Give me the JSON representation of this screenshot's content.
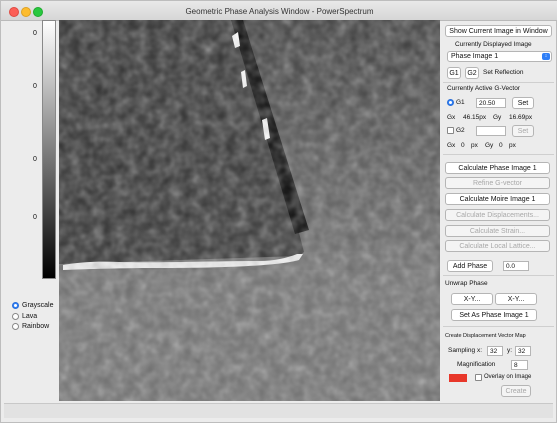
{
  "window": {
    "title": "Geometric Phase Analysis Window - PowerSpectrum"
  },
  "colorbar": {
    "labels": [
      "0",
      "0",
      "0",
      "0"
    ]
  },
  "colormap": {
    "options": [
      "Grayscale",
      "Lava",
      "Rainbow"
    ],
    "selected": "Grayscale"
  },
  "panel": {
    "show_current_btn": "Show Current Image in Window",
    "currently_displayed_label": "Currently Displayed Image",
    "displayed_select": "Phase Image 1",
    "g1_btn": "G1",
    "g2_btn": "G2",
    "set_reflection": "Set Reflection",
    "active_gvector_label": "Currently Active G-Vector",
    "g1_label": "G1",
    "g1_value": "20.50",
    "g1_set_btn": "Set",
    "gx_label": "Gx",
    "gx_value": "46.15px",
    "gy_label": "Gy",
    "gy_value": "16.69px",
    "g2_label": "G2",
    "g2_value": "",
    "g2_set_btn": "Set",
    "gx2_label": "Gx",
    "gx2_value": "0",
    "gx2_unit": "px",
    "gy2_label": "Gy",
    "gy2_value": "0",
    "gy2_unit": "px",
    "calc_phase_btn": "Calculate Phase Image 1",
    "refine_btn": "Refine G-vector",
    "calc_moire_btn": "Calculate Moire Image 1",
    "calc_disp_btn": "Calculate Displacements...",
    "calc_strain_btn": "Calculate Strain...",
    "calc_lattice_btn": "Calculate Local Lattice...",
    "add_phase_btn": "Add Phase",
    "add_phase_value": "0.0",
    "unwrap_label": "Unwrap Phase",
    "unwrap_x_btn": "X-Y...",
    "unwrap_y_btn": "X-Y...",
    "set_as_phase_btn": "Set As Phase Image 1",
    "disp_map_label": "Create Displacement Vector Map",
    "sampling_label": "Sampling",
    "x_label": "x:",
    "x_value": "32",
    "y_label": "y:",
    "y_value": "32",
    "magnification_label": "Magnification",
    "magnification_value": "8",
    "overlay_label": "Overlay on Image",
    "create_btn": "Create",
    "swatch_color": "#e8372a"
  }
}
